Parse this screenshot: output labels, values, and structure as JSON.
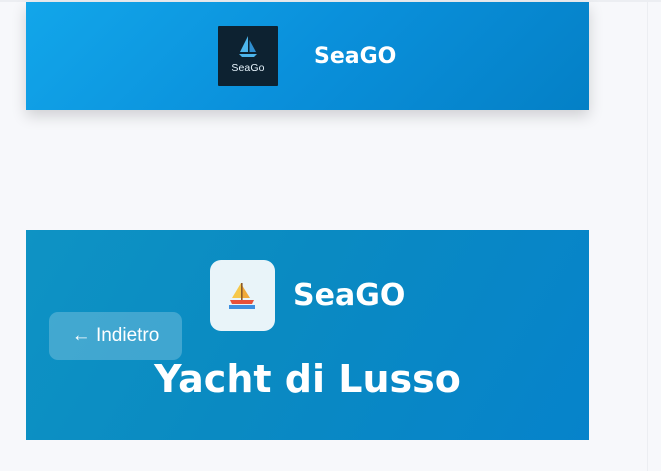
{
  "top_header": {
    "logo_text": "SeaGo",
    "brand": "SeaGO",
    "logo_icon": "sailboat-icon"
  },
  "hero": {
    "brand": "SeaGO",
    "logo_icon": "sailboat-emoji-icon",
    "back_button_label": "← Indietro",
    "title": "Yacht di Lusso"
  },
  "colors": {
    "header_gradient_start": "#12a6ea",
    "header_gradient_end": "#0480c6",
    "hero_gradient_start": "#0e93c4",
    "hero_gradient_end": "#0683cb",
    "page_background": "#f7f8fb",
    "logo_dark_background": "#0d2231",
    "logo_light_background": "#e9f4f9"
  }
}
